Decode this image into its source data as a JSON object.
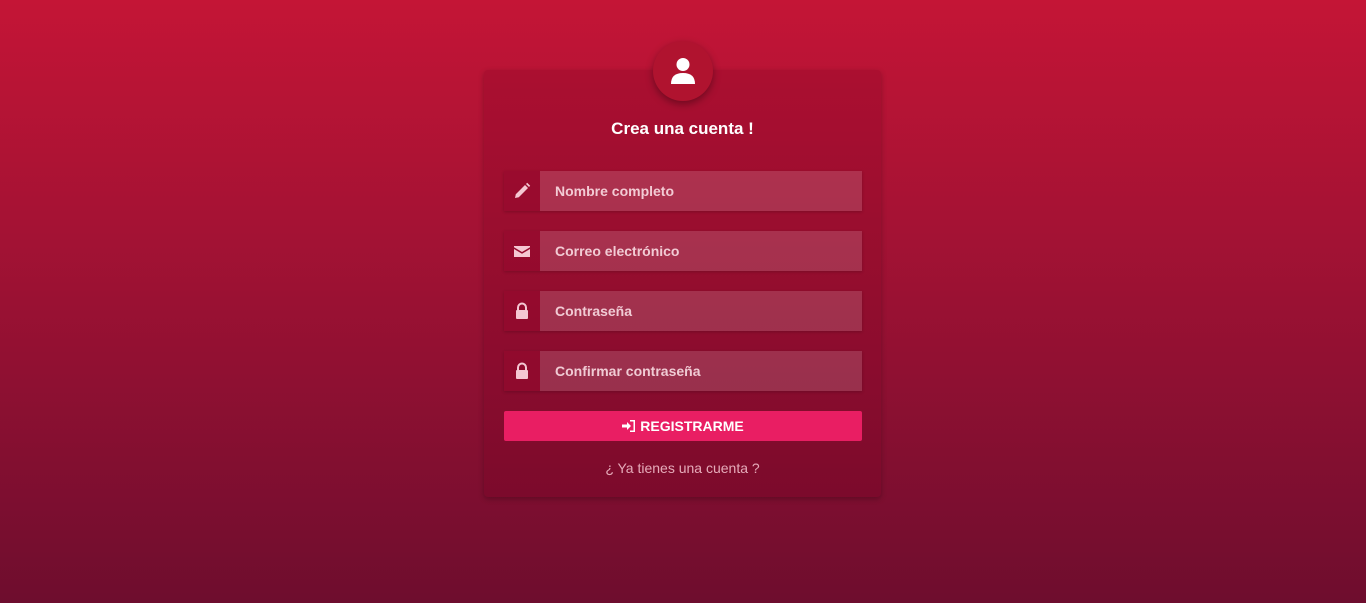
{
  "form": {
    "title": "Crea una cuenta !",
    "avatar_icon": "user-icon",
    "fields": [
      {
        "icon": "pencil-icon",
        "placeholder": "Nombre completo",
        "value": ""
      },
      {
        "icon": "envelope-icon",
        "placeholder": "Correo electrónico",
        "value": ""
      },
      {
        "icon": "lock-icon",
        "placeholder": "Contraseña",
        "value": ""
      },
      {
        "icon": "lock-icon",
        "placeholder": "Confirmar contraseña",
        "value": ""
      }
    ],
    "submit_label": "REGISTRARME",
    "submit_icon": "sign-in-icon",
    "login_link": "¿ Ya tienes una cuenta ?"
  },
  "colors": {
    "background_top": "#c41536",
    "background_bottom": "#6e0d2e",
    "button": "#e91e63"
  }
}
